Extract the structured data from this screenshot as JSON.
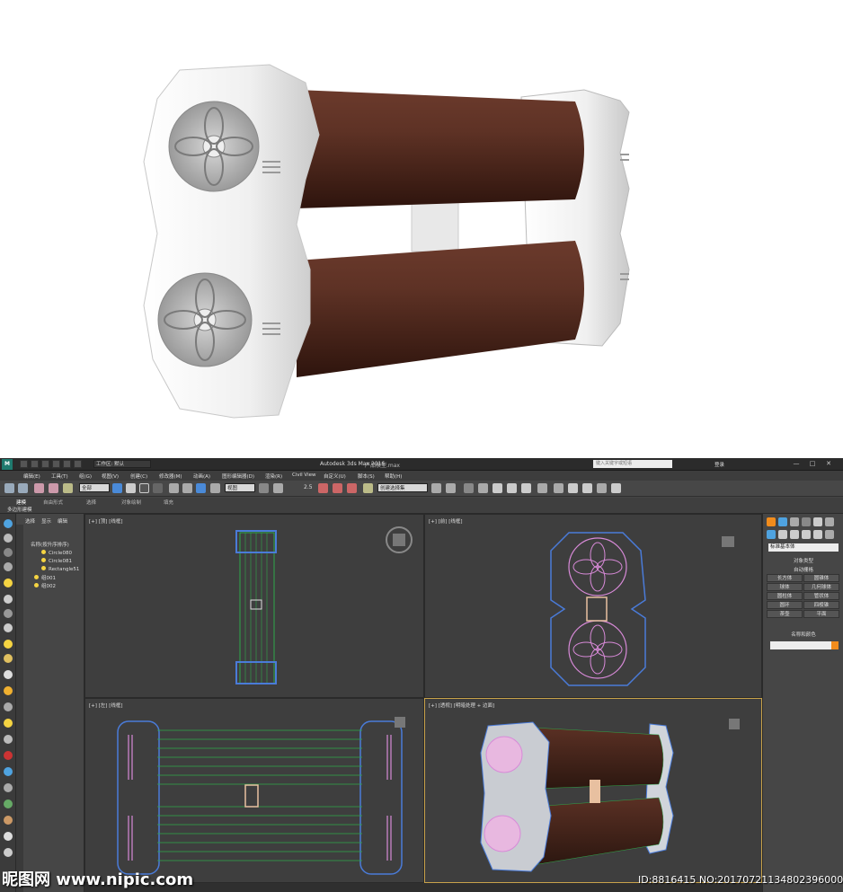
{
  "titlebar": {
    "app_title": "Autodesk 3ds Max 2016",
    "file_name": "产品模型.max",
    "workspace": "工作区: 默认",
    "search_placeholder": "键入关键字或短语",
    "login": "登录",
    "window_buttons": [
      "—",
      "□",
      "✕"
    ]
  },
  "menubar": {
    "items": [
      "编辑(E)",
      "工具(T)",
      "组(G)",
      "视图(V)",
      "创建(C)",
      "修改器(M)",
      "动画(A)",
      "图形编辑器(D)",
      "渲染(R)",
      "Civil View",
      "自定义(U)",
      "脚本(S)",
      "帮助(H)"
    ]
  },
  "toolbar": {
    "selection_filter": "全部",
    "ref_coord": "视图",
    "named_selection": "创建选择集",
    "snap_label": "2.5"
  },
  "ribbon": {
    "tabs": [
      "建模",
      "自由形式",
      "选择",
      "对象绘制",
      "填充"
    ],
    "subtitle": "多边形建模"
  },
  "scene_explorer": {
    "tabs": [
      "选择",
      "显示",
      "编辑"
    ],
    "header": "名称(按升序排序)",
    "rows": [
      "Circle080",
      "Circle081",
      "Rectangle51",
      "组001",
      "组002"
    ]
  },
  "viewports": {
    "top": "[+] [顶] [线框]",
    "front": "[+] [前] [线框]",
    "left": "[+] [左] [线框]",
    "perspective": "[+] [透视] [明暗处理 + 边面]"
  },
  "command_panel": {
    "category": "标准基本体",
    "rollout_type": "对象类型",
    "autogrid": "自动栅格",
    "buttons": [
      "长方体",
      "圆锥体",
      "球体",
      "几何球体",
      "圆柱体",
      "管状体",
      "圆环",
      "四棱锥",
      "茶壶",
      "平面"
    ],
    "rollout_name": "名称和颜色",
    "swatch_color": "#f28c1c"
  },
  "watermark": {
    "left": "昵图网 www.nipic.com",
    "right": "ID:8816415 NO:20170721134802396000"
  },
  "colors": {
    "cylinder": "#5a2e22",
    "housing": "#f2f2f2",
    "wire_blue": "#4a7bd8",
    "wire_green": "#2fa84a",
    "wire_pink": "#d88ad8"
  }
}
